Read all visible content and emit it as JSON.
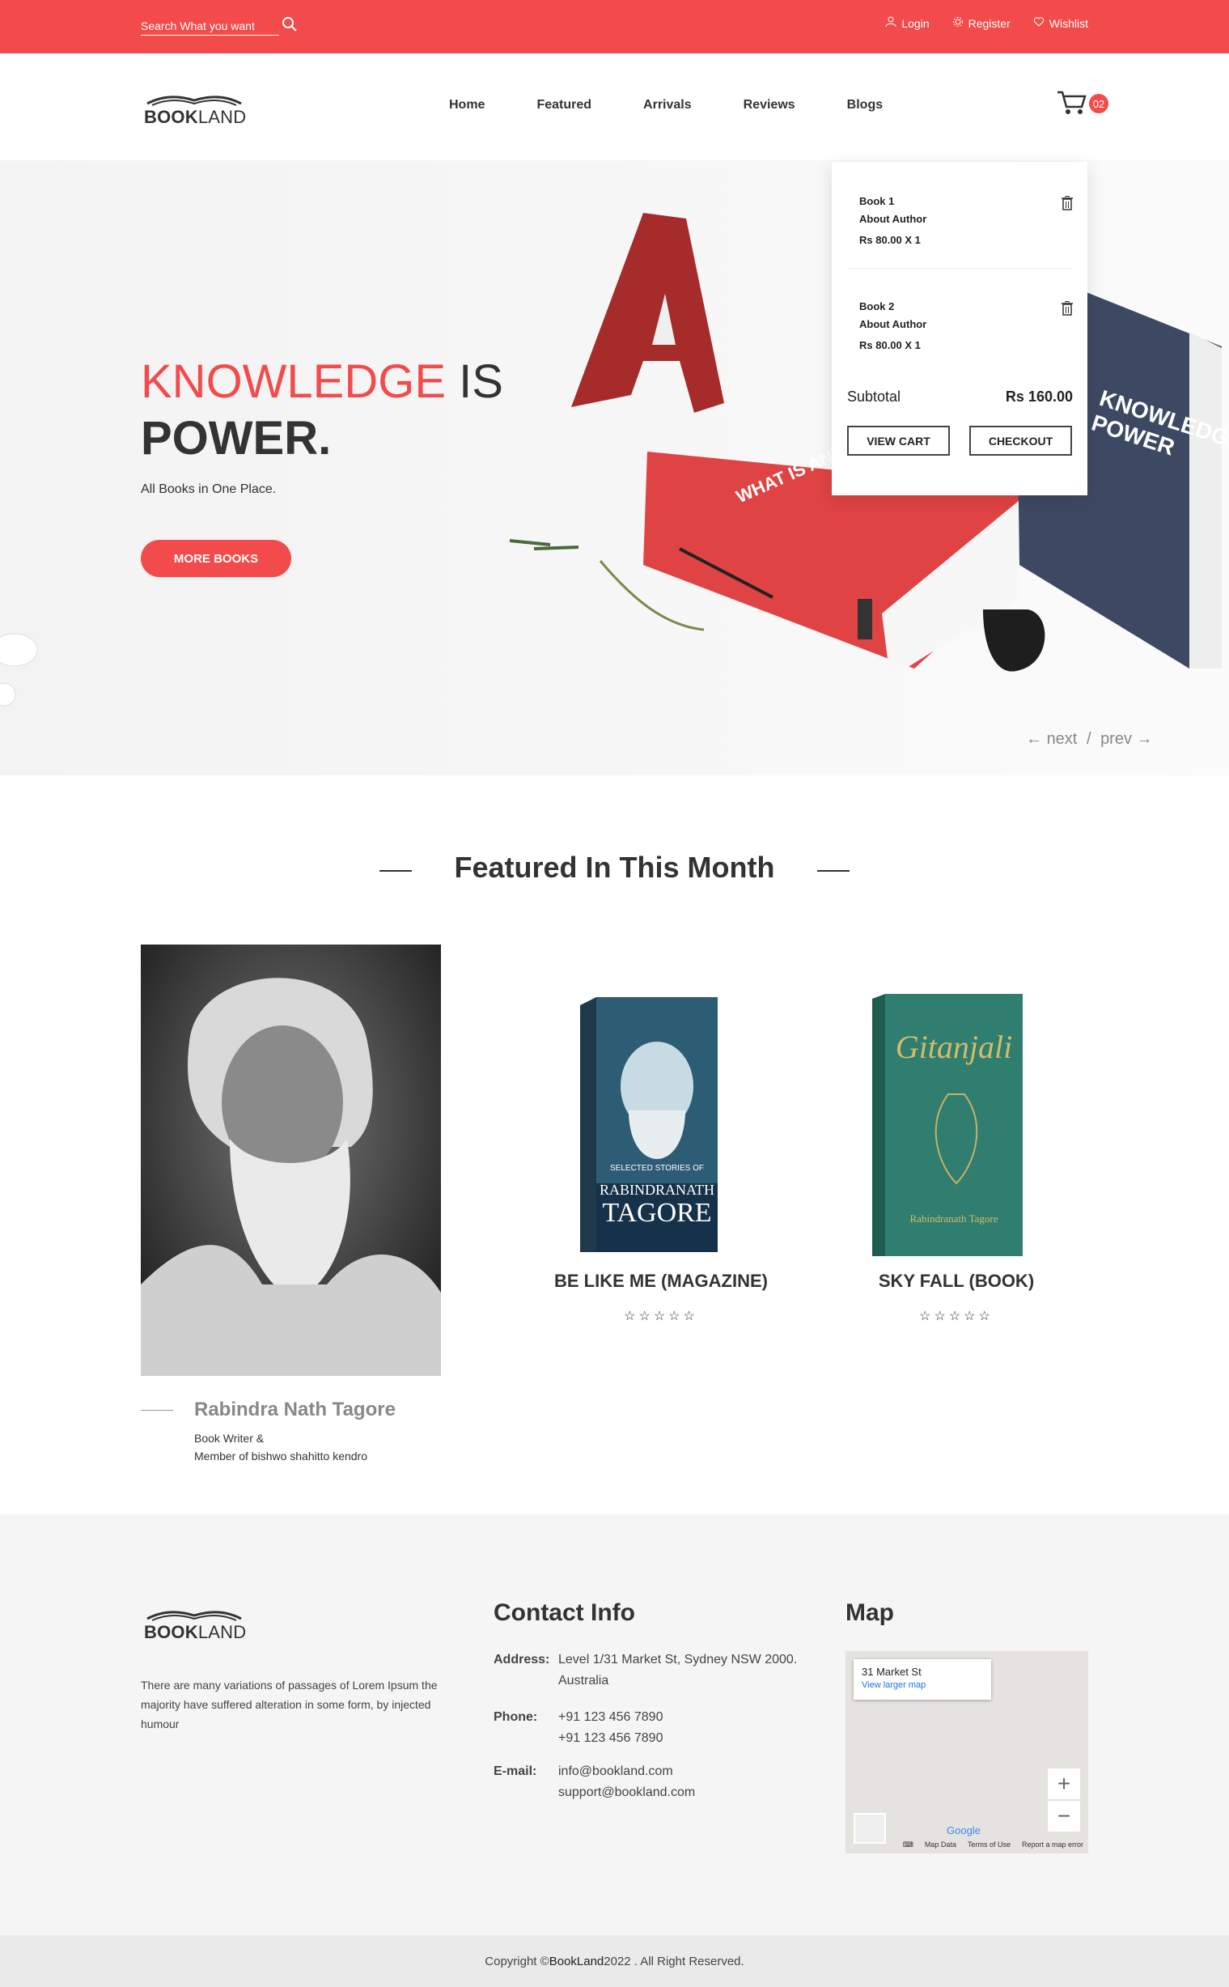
{
  "topbar": {
    "search_placeholder": "Search What you want",
    "login": "Login",
    "register": "Register",
    "wishlist": "Wishlist"
  },
  "brand": {
    "bold": "BOOK",
    "normal": "LAND"
  },
  "nav": [
    "Home",
    "Featured",
    "Arrivals",
    "Reviews",
    "Blogs"
  ],
  "cart": {
    "count": "02",
    "items": [
      {
        "title": "Book 1",
        "author": "About Author",
        "price": "Rs 80.00 X 1"
      },
      {
        "title": "Book 2",
        "author": "About Author",
        "price": "Rs 80.00 X 1"
      }
    ],
    "subtotal_label": "Subtotal",
    "subtotal_value": "Rs 160.00",
    "view_cart": "VIEW CART",
    "checkout": "CHECKOUT"
  },
  "hero": {
    "title_red": "KNOWLEDGE",
    "title_gray": " IS",
    "title_bold": "POWER.",
    "subtitle": "All Books in One Place.",
    "button": "MORE BOOKS",
    "book_red_text": "WHAT IS AND",
    "book_blue_text": "KNOWLEDGE POWER",
    "next": "next",
    "sep": "/",
    "prev": "prev"
  },
  "featured": {
    "title": "Featured In This Month",
    "author_name": "Rabindra Nath Tagore",
    "author_role_1": "Book Writer &",
    "author_role_2": "Member of bishwo shahitto kendro",
    "books": [
      {
        "title": "BE LIKE ME (MAGAZINE)",
        "cover_1": "SELECTED STORIES OF",
        "cover_2": "RABINDRANATH",
        "cover_3": "TAGORE",
        "stars": "☆☆☆☆☆"
      },
      {
        "title": "SKY FALL (BOOK)",
        "cover_1": "Gitanjali",
        "cover_2": "Rabindranath Tagore",
        "stars": "☆☆☆☆☆"
      }
    ]
  },
  "footer": {
    "desc": "There are many variations of passages of Lorem Ipsum the majority have suffered alteration in some form, by injected humour",
    "contact_title": "Contact Info",
    "address_label": "Address:",
    "address_1": "Level 1/31 Market St, Sydney NSW 2000.",
    "address_2": "Australia",
    "phone_label": "Phone:",
    "phone_1": "+91 123 456 7890",
    "phone_2": "+91 123 456 7890",
    "email_label": "E-mail:",
    "email_1": "info@bookland.com",
    "email_2": "support@bookland.com",
    "map_title": "Map",
    "map_place": "31 Market St",
    "map_link": "View larger map",
    "map_google": "Google",
    "map_data": "Map Data",
    "map_terms": "Terms of Use",
    "map_report": "Report a map error",
    "copyright_pre": "Copyright © ",
    "copyright_brand": "BookLand",
    "copyright_post": " 2022 . All Right Reserved."
  },
  "colors": {
    "accent": "#f34b4b",
    "dark": "#333333",
    "footer_bg": "#f5f5f5"
  }
}
